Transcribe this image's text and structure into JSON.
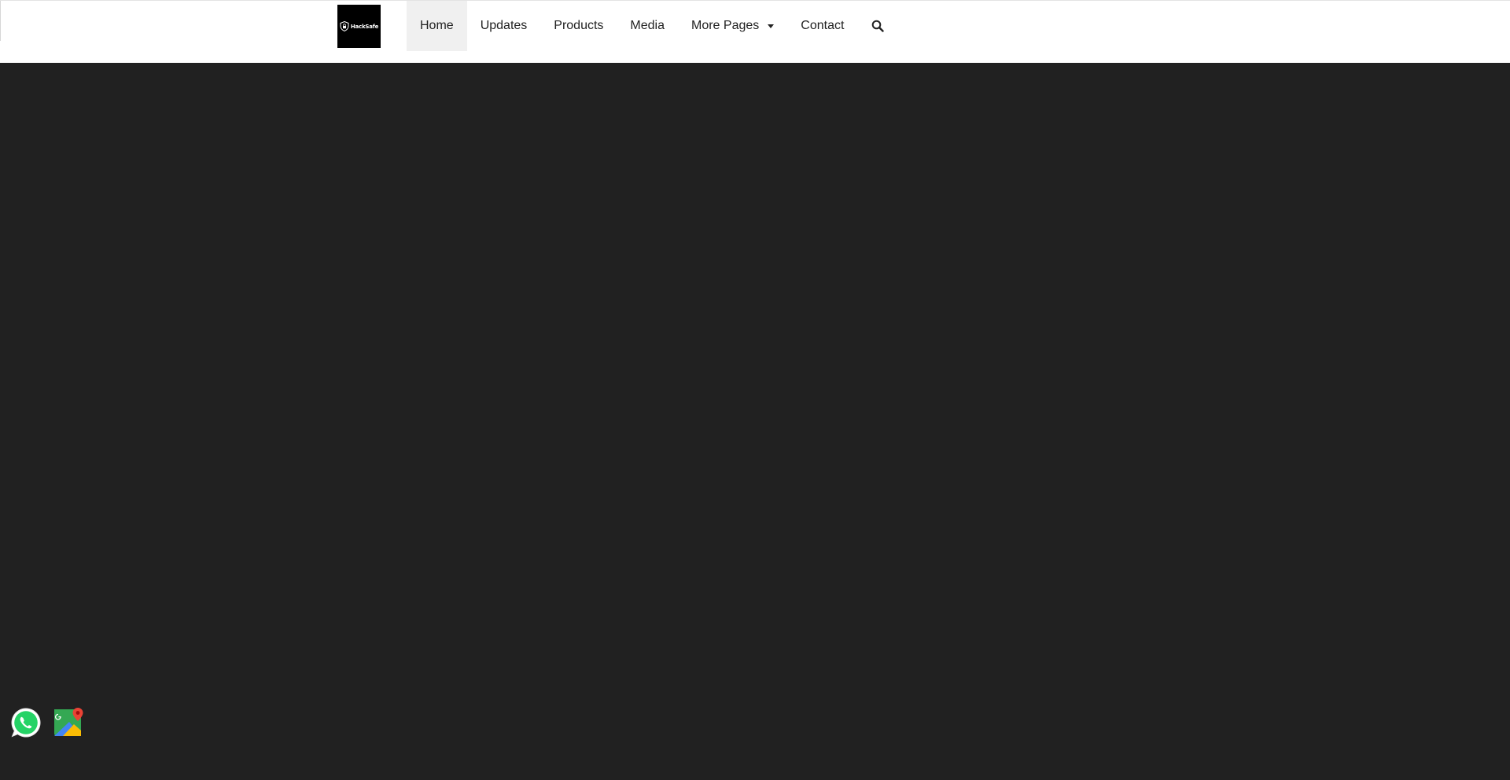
{
  "brand": {
    "logo_text": "HackSafe",
    "icon": "shield-lock-icon"
  },
  "nav": {
    "items": [
      {
        "label": "Home",
        "active": true
      },
      {
        "label": "Updates",
        "active": false
      },
      {
        "label": "Products",
        "active": false
      },
      {
        "label": "Media",
        "active": false
      },
      {
        "label": "More Pages",
        "active": false,
        "dropdown": true
      },
      {
        "label": "Contact",
        "active": false
      }
    ],
    "search_icon": "search-icon"
  },
  "floating": {
    "whatsapp_icon": "whatsapp-icon",
    "maps_icon": "google-maps-icon"
  },
  "colors": {
    "page_background": "#212121",
    "navbar_background": "#ffffff",
    "active_item_background": "#f0f0f0",
    "whatsapp_green": "#25d366"
  }
}
